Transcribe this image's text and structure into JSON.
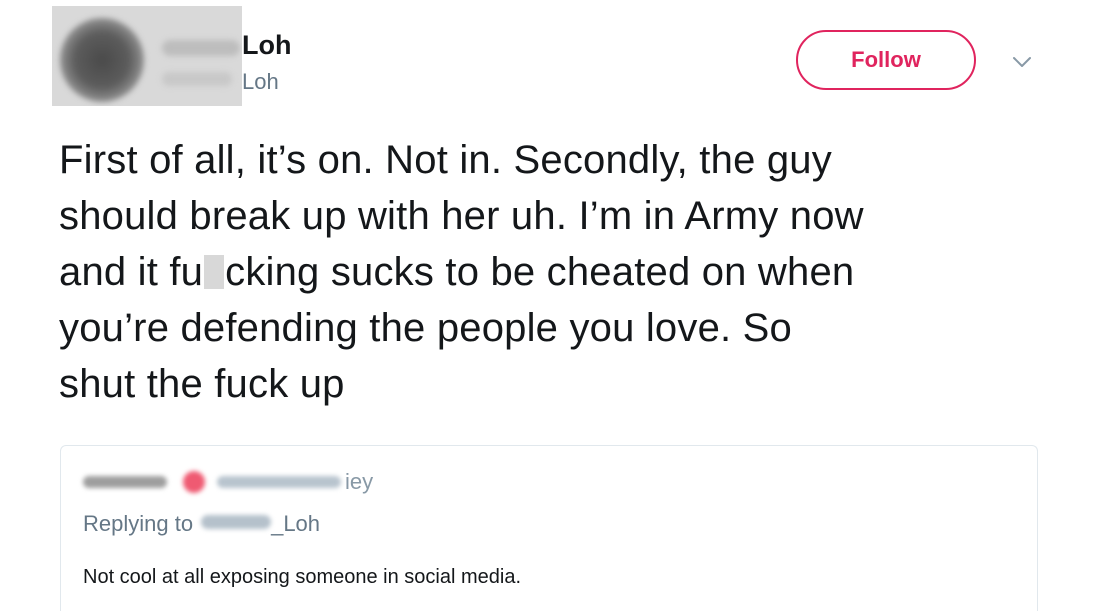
{
  "author": {
    "display_name_suffix": "Loh",
    "handle_suffix": "Loh"
  },
  "follow_button": {
    "label": "Follow",
    "color": "#e0245e"
  },
  "menu": {
    "icon": "chevron-down-icon"
  },
  "tweet": {
    "lines": [
      "First of all, it’s on. Not in. Secondly, the guy",
      "should break up with her uh. I’m in Army now",
      "cking sucks to be cheated on when",
      "you’re defending the people you love. So",
      "shut the fuck up"
    ],
    "line3_prefix": "and it fu"
  },
  "quote": {
    "handle_suffix": "iey",
    "replying_prefix": "Replying to",
    "replying_handle_suffix": "_Loh",
    "text": "Not cool at all exposing someone in social media."
  }
}
